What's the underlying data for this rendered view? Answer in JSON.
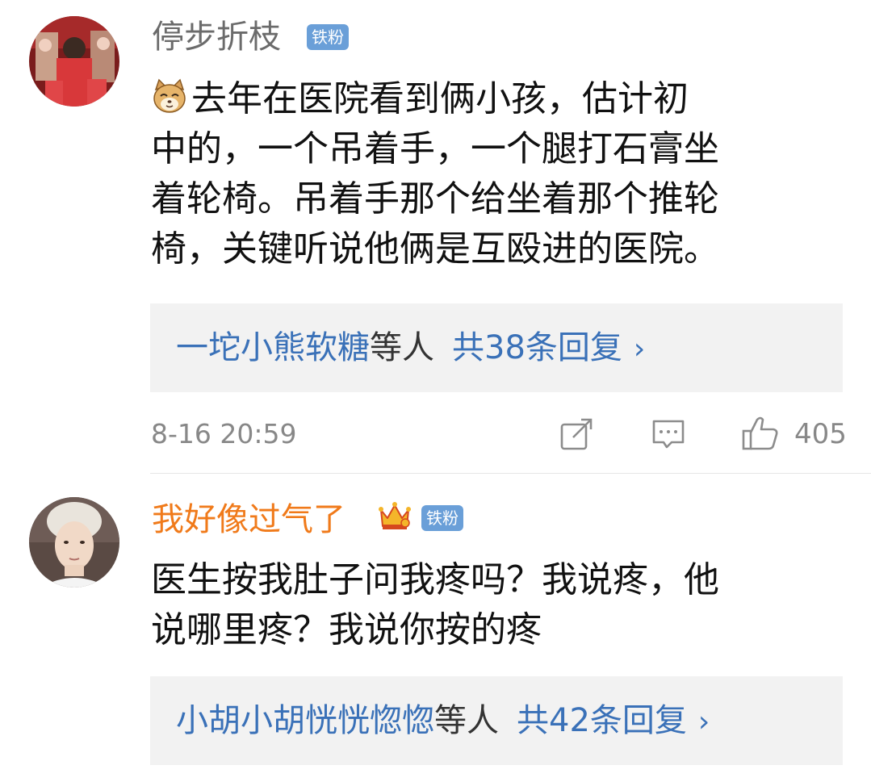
{
  "comments": [
    {
      "username": "停步折枝",
      "username_color": "#6b6b6b",
      "badge": "铁粉",
      "emoji_icon": "cat-face-icon",
      "text_lines": [
        "去年在医院看到俩小孩，估计初",
        "中的，一个吊着手，一个腿打石膏坐",
        "着轮椅。吊着手那个给坐着那个推轮",
        "椅，关键听说他俩是互殴进的医院。"
      ],
      "replies": {
        "names": "一坨小熊软糖",
        "mid": "等人",
        "total": "共38条回复",
        "arrow": "›"
      },
      "time": "8-16 20:59",
      "likes": "405"
    },
    {
      "username": "我好像过气了",
      "username_color": "#f07a1a",
      "badge": "铁粉",
      "text_lines": [
        "医生按我肚子问我疼吗？我说疼，他",
        "说哪里疼？我说你按的疼"
      ],
      "replies": {
        "names": "小胡小胡恍恍惚惚",
        "mid": "等人",
        "total": "共42条回复",
        "arrow": "›"
      }
    }
  ],
  "colors": {
    "link_blue": "#3a71b8",
    "badge_blue": "#6a9fd8",
    "meta_gray": "#888888",
    "reply_bg": "#f2f2f2"
  }
}
